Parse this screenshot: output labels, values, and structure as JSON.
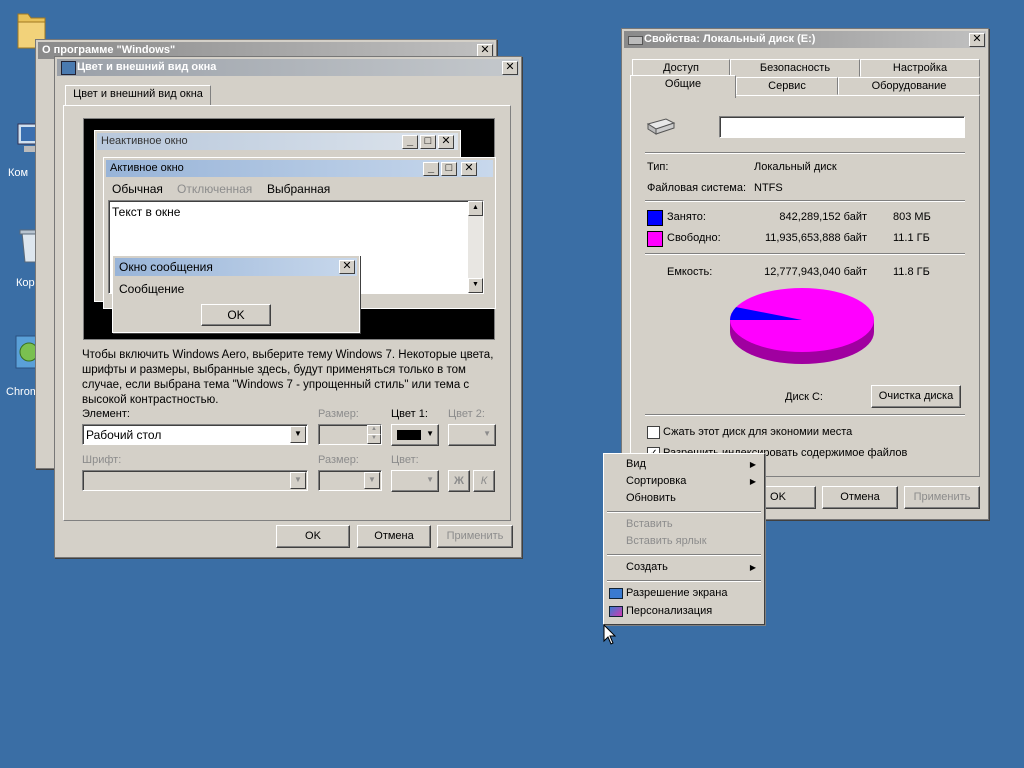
{
  "desktop": {
    "icons": [
      {
        "label": "Ком",
        "icon": "computer-icon"
      },
      {
        "label": "Кор",
        "icon": "recycle-bin-icon"
      },
      {
        "label": "Chrom",
        "icon": "chrome-installer-icon"
      }
    ]
  },
  "about_window": {
    "title": "О программе \"Windows\""
  },
  "appearance_window": {
    "title": "Цвет и внешний вид окна",
    "tab": "Цвет и внешний вид окна",
    "preview": {
      "inactive_title": "Неактивное окно",
      "active_title": "Активное окно",
      "menu": [
        "Обычная",
        "Отключенная",
        "Выбранная"
      ],
      "window_text": "Текст в окне",
      "msgbox_title": "Окно сообщения",
      "msgbox_text": "Сообщение",
      "msgbox_ok": "OK"
    },
    "info_text": "Чтобы включить Windows Aero, выберите тему Windows 7. Некоторые цвета, шрифты и размеры, выбранные здесь, будут применяться только в том случае, если выбрана тема \"Windows 7 - упрощенный стиль\" или тема с высокой контрастностью.",
    "element_label": "Элемент:",
    "element_value": "Рабочий стол",
    "size_label": "Размер:",
    "color1_label": "Цвет 1:",
    "color2_label": "Цвет 2:",
    "font_label": "Шрифт:",
    "font_size_label": "Размер:",
    "font_color_label": "Цвет:",
    "bold_label": "Ж",
    "italic_label": "К",
    "color1_value": "#000000",
    "ok": "OK",
    "cancel": "Отмена",
    "apply": "Применить"
  },
  "disk_window": {
    "title": "Свойства: Локальный диск (E:)",
    "tabs_row1": [
      "Доступ",
      "Безопасность",
      "Настройка"
    ],
    "tabs_row2": [
      "Общие",
      "Сервис",
      "Оборудование"
    ],
    "name_value": "",
    "type_label": "Тип:",
    "type_value": "Локальный диск",
    "fs_label": "Файловая система:",
    "fs_value": "NTFS",
    "used_label": "Занято:",
    "used_bytes": "842,289,152 байт",
    "used_size": "803 МБ",
    "free_label": "Свободно:",
    "free_bytes": "11,935,653,888 байт",
    "free_size": "11.1 ГБ",
    "capacity_label": "Емкость:",
    "capacity_bytes": "12,777,943,040 байт",
    "capacity_size": "11.8 ГБ",
    "used_color": "#0000ff",
    "free_color": "#ff00ff",
    "used_fraction": 0.066,
    "disk_label": "Диск C:",
    "cleanup": "Очистка диска",
    "compress_label": "Сжать этот диск для экономии места",
    "compress_checked": false,
    "index_label": "Разрешить индексировать содержимое файлов",
    "index_checked": true,
    "ok": "OK",
    "cancel": "Отмена",
    "apply": "Применить"
  },
  "context_menu": {
    "items": [
      {
        "label": "Вид",
        "submenu": true,
        "disabled": false
      },
      {
        "label": "Сортировка",
        "submenu": true,
        "disabled": false
      },
      {
        "label": "Обновить",
        "submenu": false,
        "disabled": false
      },
      {
        "label": "Вставить",
        "submenu": false,
        "disabled": true
      },
      {
        "label": "Вставить ярлык",
        "submenu": false,
        "disabled": true
      },
      {
        "label": "Создать",
        "submenu": true,
        "disabled": false
      },
      {
        "label": "Разрешение экрана",
        "submenu": false,
        "disabled": false,
        "icon": "display-resolution-icon"
      },
      {
        "label": "Персонализация",
        "submenu": false,
        "disabled": false,
        "icon": "personalization-icon"
      }
    ]
  },
  "colors": {
    "desktop": "#3a6ea5",
    "window": "#d4d0c8"
  }
}
